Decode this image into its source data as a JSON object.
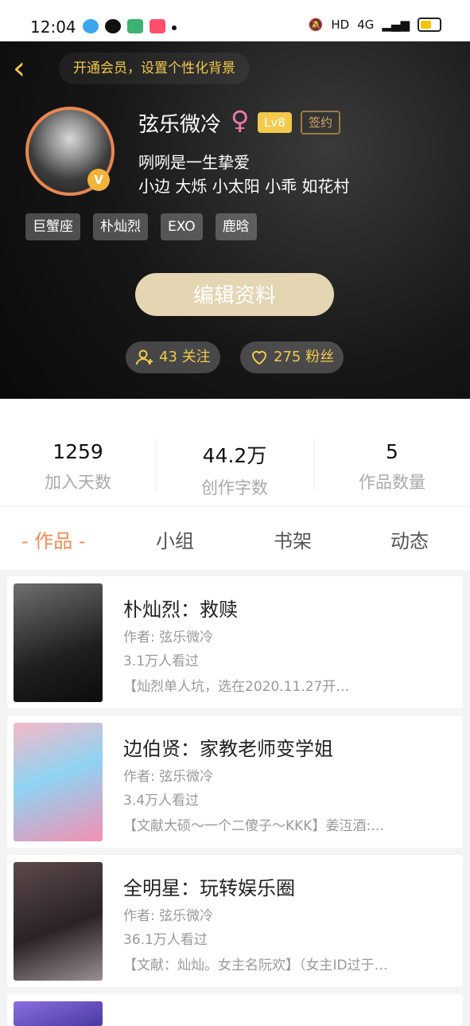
{
  "status_bar": {
    "time": "12:04",
    "network": "HD",
    "cellular": "4G"
  },
  "header": {
    "back_glyph": "‹",
    "vip_banner": "开通会员，设置个性化背景",
    "username": "弦乐微冷",
    "gender_symbol": "♀",
    "level": "Lv8",
    "signed_label": "签约",
    "bio_line1": "咧咧是一生挚爱",
    "bio_line2": "小边 大烁 小太阳 小乖 如花村",
    "verified_badge": "V",
    "tags": [
      "巨蟹座",
      "朴灿烈",
      "EXO",
      "鹿晗"
    ],
    "edit_button": "编辑资料",
    "following": "43 关注",
    "fans": "275 粉丝"
  },
  "stats": [
    {
      "value": "1259",
      "label": "加入天数"
    },
    {
      "value": "44.2万",
      "label": "创作字数"
    },
    {
      "value": "5",
      "label": "作品数量"
    }
  ],
  "tabs": [
    "- 作品 -",
    "小组",
    "书架",
    "动态"
  ],
  "works": [
    {
      "title": "朴灿烈：救赎",
      "author": "作者: 弦乐微冷",
      "views": "3.1万人看过",
      "desc": "【灿烈单人坑，选在2020.11.27开…"
    },
    {
      "title": "边伯贤：家教老师变学姐",
      "author": "作者: 弦乐微冷",
      "views": "3.4万人看过",
      "desc": "【文献大硕～一个二傻子～KKK】姜沍酒:…"
    },
    {
      "title": "全明星：玩转娱乐圈",
      "author": "作者: 弦乐微冷",
      "views": "36.1万人看过",
      "desc": "【文献：灿灿。女主名阮欢】（女主ID过于…"
    }
  ],
  "colors": {
    "accent": "#f2c94c",
    "tab_active": "#f08c5a",
    "edit_button": "#e4d5b3",
    "avatar_ring": "#e8874f"
  }
}
